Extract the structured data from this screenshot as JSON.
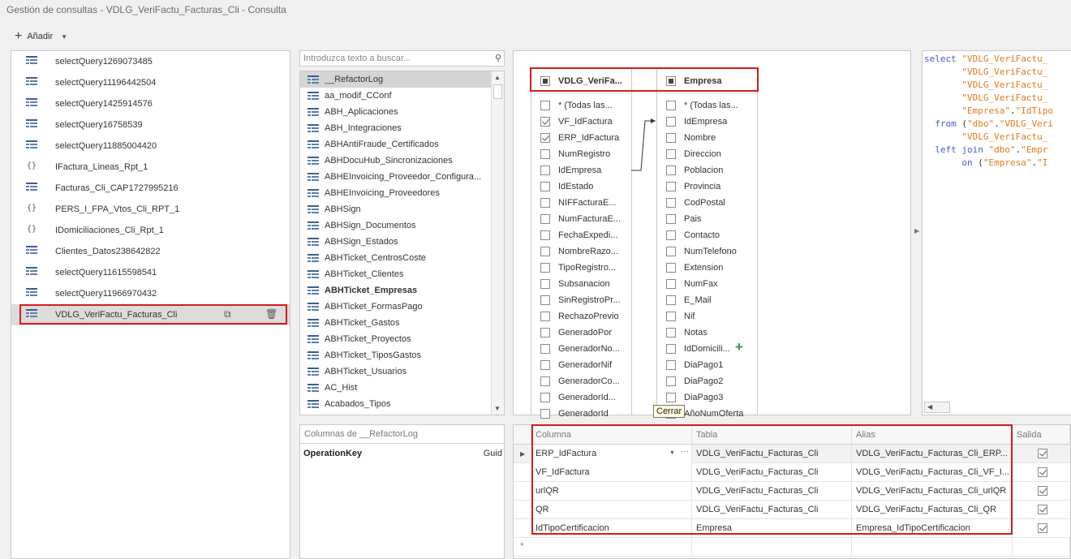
{
  "title": "Gestión de consultas - VDLG_VeriFactu_Facturas_Cli - Consulta",
  "toolbar": {
    "add_label": "Añadir"
  },
  "queries": [
    {
      "label": "selectQuery1269073485",
      "icon": "table-icon"
    },
    {
      "label": "selectQuery11196442504",
      "icon": "table-icon"
    },
    {
      "label": "selectQuery1425914576",
      "icon": "table-icon"
    },
    {
      "label": "selectQuery16758539",
      "icon": "table-icon"
    },
    {
      "label": "selectQuery11885004420",
      "icon": "table-icon"
    },
    {
      "label": "IFactura_Lineas_Rpt_1",
      "icon": "braces-icon"
    },
    {
      "label": "Facturas_Cli_CAP1727995216",
      "icon": "table-icon"
    },
    {
      "label": "PERS_I_FPA_Vtos_Cli_RPT_1",
      "icon": "braces-icon"
    },
    {
      "label": "IDomiciliaciones_Cli_Rpt_1",
      "icon": "braces-icon"
    },
    {
      "label": "Clientes_Datos238642822",
      "icon": "table-icon"
    },
    {
      "label": "selectQuery11615598541",
      "icon": "table-icon"
    },
    {
      "label": "selectQuery11966970432",
      "icon": "table-icon"
    },
    {
      "label": "VDLG_VeriFactu_Facturas_Cli",
      "icon": "table-icon"
    }
  ],
  "search": {
    "placeholder": "Introduzca texto a buscar..."
  },
  "tables": [
    "__RefactorLog",
    "aa_modif_CConf",
    "ABH_Aplicaciones",
    "ABH_Integraciones",
    "ABHAntiFraude_Certificados",
    "ABHDocuHub_Sincronizaciones",
    "ABHEInvoicing_Proveedor_Configura...",
    "ABHEInvoicing_Proveedores",
    "ABHSign",
    "ABHSign_Documentos",
    "ABHSign_Estados",
    "ABHTicket_CentrosCoste",
    "ABHTicket_Clientes",
    "ABHTicket_Empresas",
    "ABHTicket_FormasPago",
    "ABHTicket_Gastos",
    "ABHTicket_Proyectos",
    "ABHTicket_TiposGastos",
    "ABHTicket_Usuarios",
    "AC_Hist",
    "Acabados_Tipos"
  ],
  "columns_panel": {
    "header": "Columnas de __RefactorLog",
    "row_name": "OperationKey",
    "row_type": "Guid"
  },
  "diagram": {
    "left_table": {
      "name": "VDLG_VeriFa...",
      "fields": [
        {
          "name": "* (Todas las...",
          "checked": false
        },
        {
          "name": "VF_IdFactura",
          "checked": true
        },
        {
          "name": "ERP_IdFactura",
          "checked": true
        },
        {
          "name": "NumRegistro",
          "checked": false
        },
        {
          "name": "IdEmpresa",
          "checked": false
        },
        {
          "name": "IdEstado",
          "checked": false
        },
        {
          "name": "NIFFacturaE...",
          "checked": false
        },
        {
          "name": "NumFacturaE...",
          "checked": false
        },
        {
          "name": "FechaExpedi...",
          "checked": false
        },
        {
          "name": "NombreRazo...",
          "checked": false
        },
        {
          "name": "TipoRegistro...",
          "checked": false
        },
        {
          "name": "Subsanacion",
          "checked": false
        },
        {
          "name": "SinRegistroPr...",
          "checked": false
        },
        {
          "name": "RechazoPrevio",
          "checked": false
        },
        {
          "name": "GeneradoPor",
          "checked": false
        },
        {
          "name": "GeneradorNo...",
          "checked": false
        },
        {
          "name": "GeneradorNif",
          "checked": false
        },
        {
          "name": "GeneradorCo...",
          "checked": false
        },
        {
          "name": "GeneradorId...",
          "checked": false
        },
        {
          "name": "GeneradorId",
          "checked": false
        }
      ]
    },
    "right_table": {
      "name": "Empresa",
      "fields": [
        {
          "name": "* (Todas las...",
          "checked": false
        },
        {
          "name": "IdEmpresa",
          "checked": false
        },
        {
          "name": "Nombre",
          "checked": false
        },
        {
          "name": "Direccion",
          "checked": false
        },
        {
          "name": "Poblacion",
          "checked": false
        },
        {
          "name": "Provincia",
          "checked": false
        },
        {
          "name": "CodPostal",
          "checked": false
        },
        {
          "name": "Pais",
          "checked": false
        },
        {
          "name": "Contacto",
          "checked": false
        },
        {
          "name": "NumTelefono",
          "checked": false
        },
        {
          "name": "Extension",
          "checked": false
        },
        {
          "name": "NumFax",
          "checked": false
        },
        {
          "name": "E_Mail",
          "checked": false
        },
        {
          "name": "Nif",
          "checked": false
        },
        {
          "name": "Notas",
          "checked": false
        },
        {
          "name": "IdDomicili...",
          "checked": false
        },
        {
          "name": "DiaPago1",
          "checked": false
        },
        {
          "name": "DiaPago2",
          "checked": false
        },
        {
          "name": "DiaPago3",
          "checked": false
        },
        {
          "name": "AñoNumOferta",
          "checked": false
        }
      ]
    },
    "tooltip": "Cerrar"
  },
  "sql": {
    "lines": [
      [
        {
          "t": "select ",
          "c": "kw"
        },
        {
          "t": "\"VDLG_VeriFactu_",
          "c": "st"
        }
      ],
      [
        {
          "t": "       ",
          "c": ""
        },
        {
          "t": "\"VDLG_VeriFactu_",
          "c": "st"
        }
      ],
      [
        {
          "t": "       ",
          "c": ""
        },
        {
          "t": "\"VDLG_VeriFactu_",
          "c": "st"
        }
      ],
      [
        {
          "t": "       ",
          "c": ""
        },
        {
          "t": "\"VDLG_VeriFactu_",
          "c": "st"
        }
      ],
      [
        {
          "t": "       ",
          "c": ""
        },
        {
          "t": "\"Empresa\"",
          "c": "st"
        },
        {
          "t": ".",
          "c": ""
        },
        {
          "t": "\"IdTipo",
          "c": "st"
        }
      ],
      [
        {
          "t": "  from ",
          "c": "kw"
        },
        {
          "t": "(",
          "c": ""
        },
        {
          "t": "\"dbo\"",
          "c": "st"
        },
        {
          "t": ".",
          "c": ""
        },
        {
          "t": "\"VDLG_Veri",
          "c": "st"
        }
      ],
      [
        {
          "t": "       ",
          "c": ""
        },
        {
          "t": "\"VDLG_VeriFactu_",
          "c": "st"
        }
      ],
      [
        {
          "t": "  left join ",
          "c": "kw"
        },
        {
          "t": "\"dbo\"",
          "c": "st"
        },
        {
          "t": ".",
          "c": ""
        },
        {
          "t": "\"Empr",
          "c": "st"
        }
      ],
      [
        {
          "t": "       on ",
          "c": "kw"
        },
        {
          "t": "(",
          "c": ""
        },
        {
          "t": "\"Empresa\"",
          "c": "st"
        },
        {
          "t": ".",
          "c": ""
        },
        {
          "t": "\"I",
          "c": "st"
        }
      ]
    ]
  },
  "grid": {
    "headers": {
      "column": "Columna",
      "table": "Tabla",
      "alias": "Alias",
      "output": "Salida"
    },
    "rows": [
      {
        "column": "ERP_IdFactura",
        "table": "VDLG_VeriFactu_Facturas_Cli",
        "alias": "VDLG_VeriFactu_Facturas_Cli_ERP...",
        "output": true
      },
      {
        "column": "VF_IdFactura",
        "table": "VDLG_VeriFactu_Facturas_Cli",
        "alias": "VDLG_VeriFactu_Facturas_Cli_VF_I...",
        "output": true
      },
      {
        "column": "urlQR",
        "table": "VDLG_VeriFactu_Facturas_Cli",
        "alias": "VDLG_VeriFactu_Facturas_Cli_urlQR",
        "output": true
      },
      {
        "column": "QR",
        "table": "VDLG_VeriFactu_Facturas_Cli",
        "alias": "VDLG_VeriFactu_Facturas_Cli_QR",
        "output": true
      },
      {
        "column": "IdTipoCertificacion",
        "table": "Empresa",
        "alias": "Empresa_IdTipoCertificacion",
        "output": true
      }
    ]
  },
  "colors": {
    "highlight_red": "#d21c1c",
    "keyword": "#3b63c4",
    "string": "#e07b1a",
    "add_green": "#3a9a3a"
  }
}
